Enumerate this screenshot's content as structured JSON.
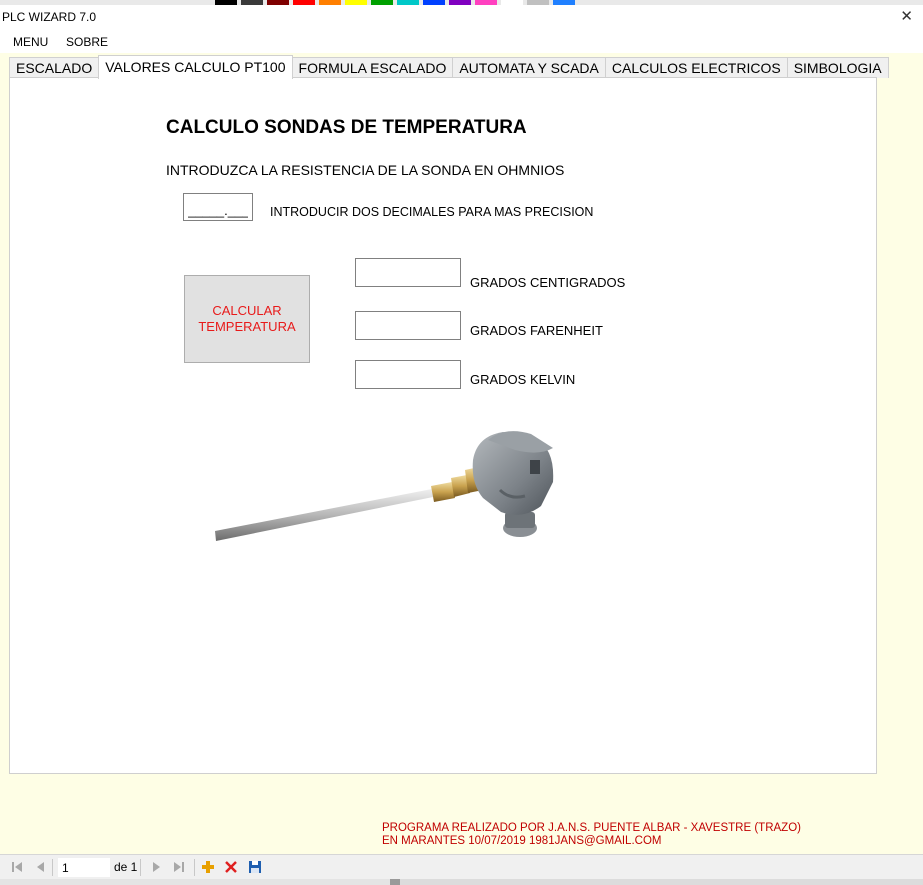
{
  "window": {
    "title": "PLC WIZARD 7.0",
    "close_symbol": "✕"
  },
  "menu": {
    "items": [
      "MENU",
      "SOBRE"
    ]
  },
  "tabs": [
    {
      "label": "ESCALADO",
      "active": false
    },
    {
      "label": "VALORES CALCULO PT100",
      "active": true
    },
    {
      "label": "FORMULA ESCALADO",
      "active": false
    },
    {
      "label": "AUTOMATA Y SCADA",
      "active": false
    },
    {
      "label": "CALCULOS ELECTRICOS",
      "active": false
    },
    {
      "label": "SIMBOLOGIA",
      "active": false
    }
  ],
  "content": {
    "heading": "CALCULO SONDAS DE TEMPERATURA",
    "instruction": "INTRODUZCA LA RESISTENCIA DE LA SONDA EN OHMNIOS",
    "resistance_input": {
      "value": "_____.___",
      "placeholder": ""
    },
    "precision_hint": "INTRODUCIR DOS DECIMALES PARA MAS PRECISION",
    "calc_button_label": "CALCULAR\nTEMPERATURA",
    "outputs": [
      {
        "label": "GRADOS CENTIGRADOS",
        "value": ""
      },
      {
        "label": "GRADOS FARENHEIT",
        "value": ""
      },
      {
        "label": "GRADOS KELVIN",
        "value": ""
      }
    ],
    "image_icon": "pt100-sensor-image"
  },
  "credits": {
    "line1": "PROGRAMA REALIZADO POR J.A.N.S.  PUENTE ALBAR - XAVESTRE  (TRAZO)",
    "line2": "EN MARANTES 10/07/2019  1981JANS@GMAIL.COM"
  },
  "navigator": {
    "position": "1",
    "of_label": "de 1",
    "icons": [
      "move-first-icon",
      "move-previous-icon",
      "move-next-icon",
      "move-last-icon",
      "add-new-icon",
      "delete-icon",
      "save-icon"
    ]
  },
  "colors": {
    "background": "#fefee5",
    "accent_red": "#e81a1a",
    "credits_red": "#c00000",
    "add_icon": "#e8a000",
    "delete_icon": "#e02020",
    "save_icon": "#1f5fb0"
  }
}
